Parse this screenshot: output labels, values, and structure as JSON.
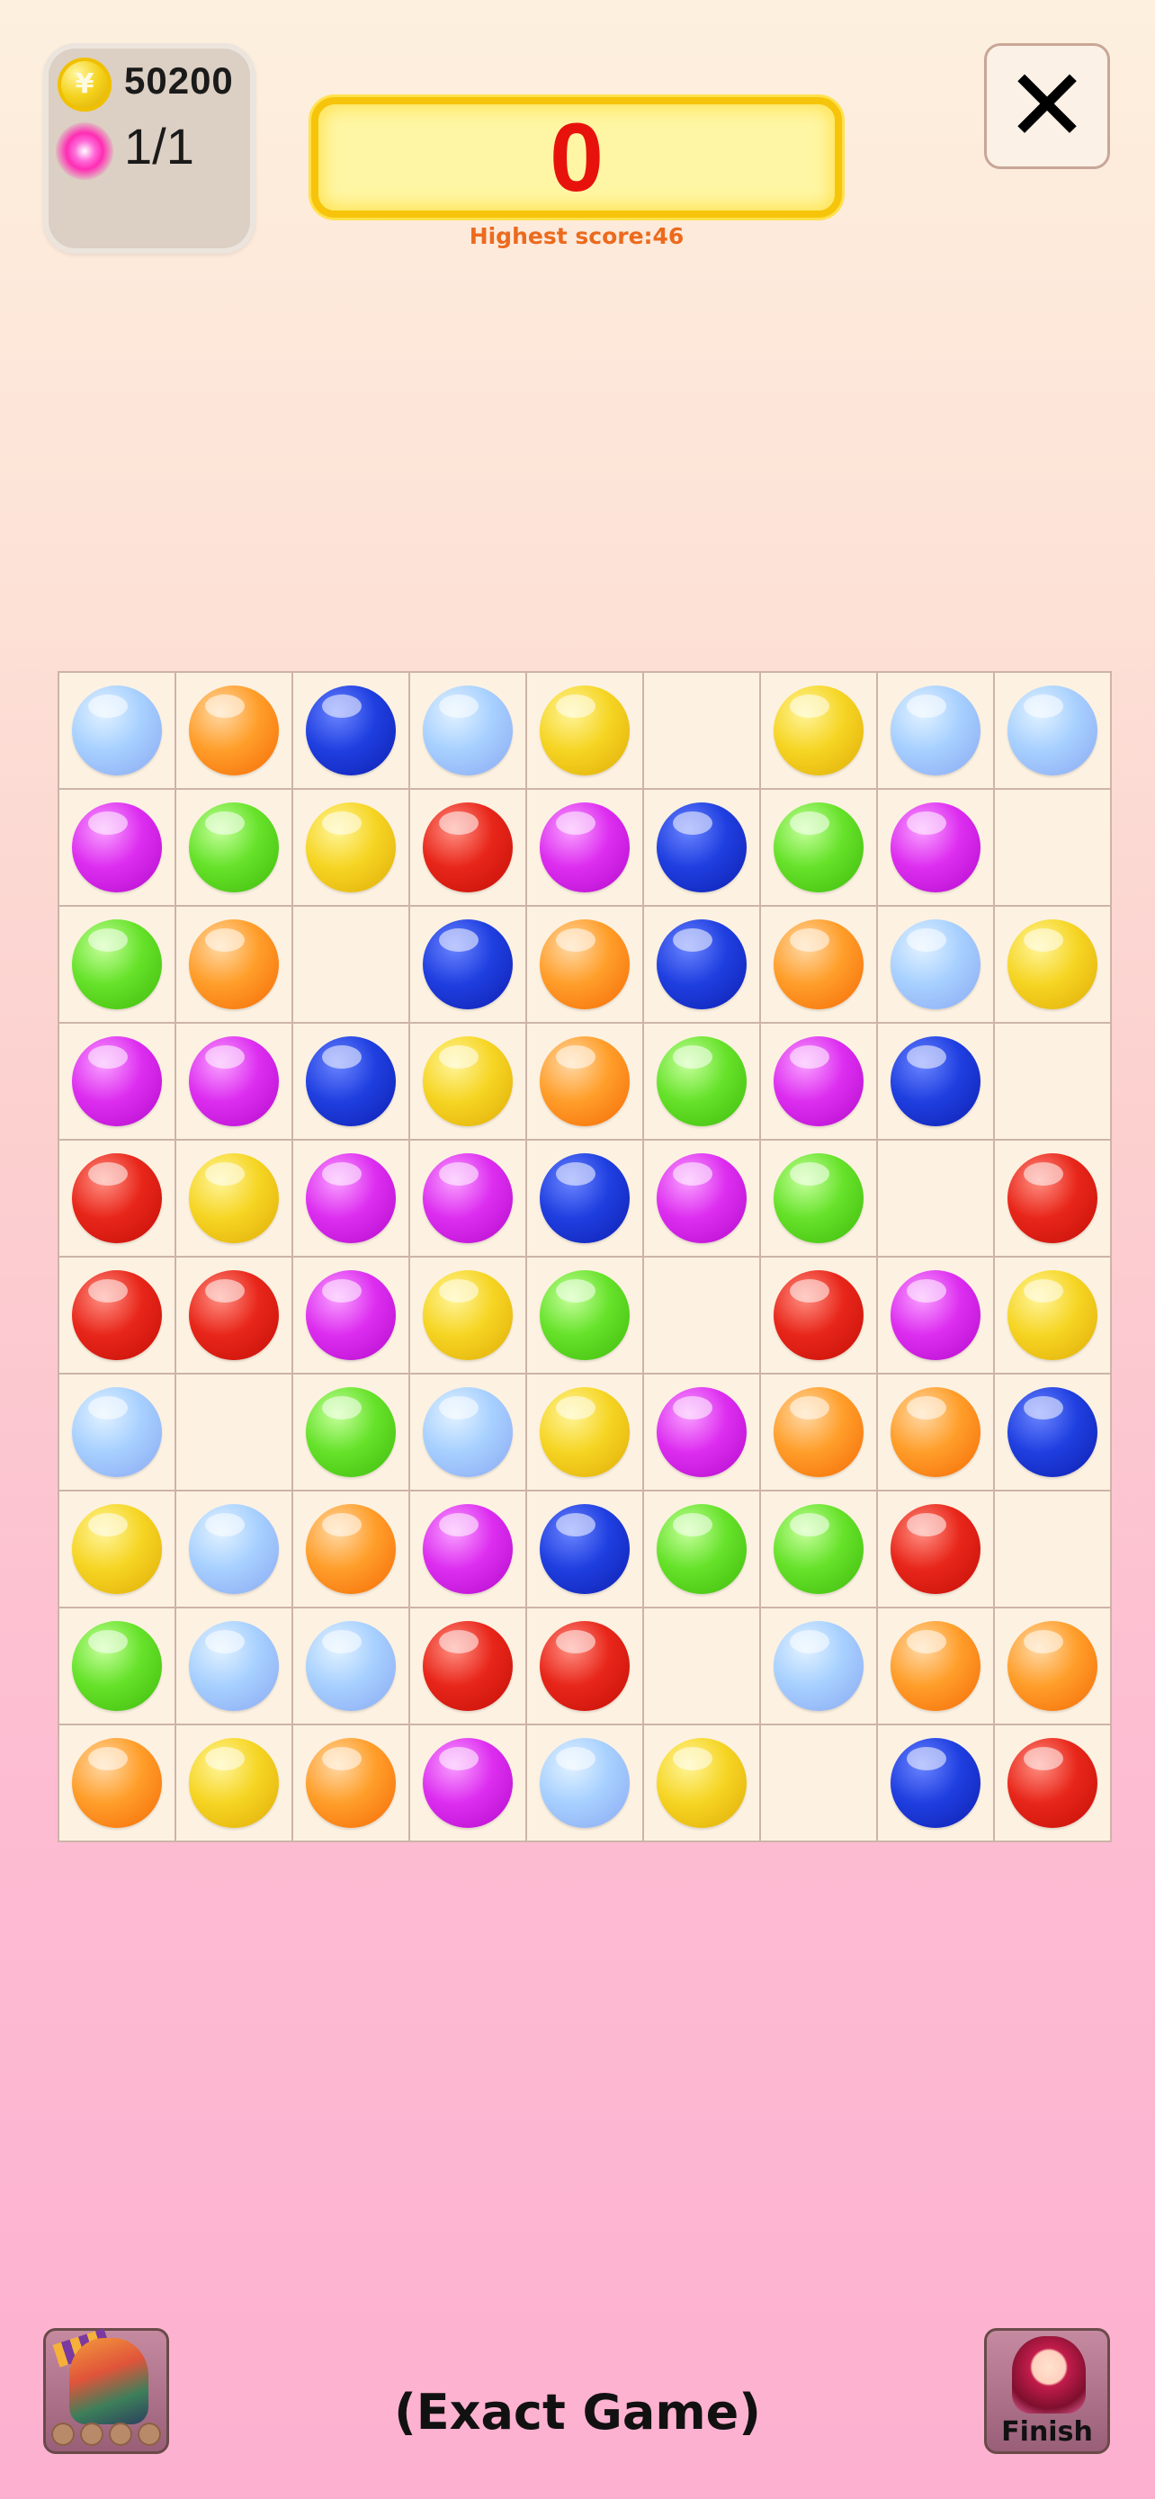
{
  "resources": {
    "coin_symbol": "¥",
    "coins": "50200",
    "energy": "1/1"
  },
  "score": {
    "current": "0",
    "best_label": "Highest score:46"
  },
  "close_icon_glyph": "✕",
  "board": {
    "rows": 10,
    "cols": 9,
    "color_palette": {
      "sky": "#a7d0ff",
      "orange": "#ff9e2a",
      "blue": "#1f3fe0",
      "yellow": "#f6d524",
      "purple": "#dd2ef0",
      "green": "#66e22a",
      "red": "#e8261a"
    },
    "grid": [
      [
        "sky",
        "orange",
        "blue",
        "sky",
        "yellow",
        null,
        "yellow",
        "sky",
        "sky"
      ],
      [
        "purple",
        "green",
        "yellow",
        "red",
        "purple",
        "blue",
        "green",
        "purple",
        null
      ],
      [
        "green",
        "orange",
        null,
        "blue",
        "orange",
        "blue",
        "orange",
        "sky",
        "yellow"
      ],
      [
        "purple",
        "purple",
        "blue",
        "yellow",
        "orange",
        "green",
        "purple",
        "blue",
        null
      ],
      [
        "red",
        "yellow",
        "purple",
        "purple",
        "blue",
        "purple",
        "green",
        null,
        "red"
      ],
      [
        "red",
        "red",
        "purple",
        "yellow",
        "green",
        null,
        "red",
        "purple",
        "yellow"
      ],
      [
        "sky",
        null,
        "green",
        "sky",
        "yellow",
        "purple",
        "orange",
        "orange",
        "blue"
      ],
      [
        "yellow",
        "sky",
        "orange",
        "purple",
        "blue",
        "green",
        "green",
        "red",
        null
      ],
      [
        "green",
        "sky",
        "sky",
        "red",
        "red",
        null,
        "sky",
        "orange",
        "orange"
      ],
      [
        "orange",
        "yellow",
        "orange",
        "purple",
        "sky",
        "yellow",
        null,
        "blue",
        "red"
      ]
    ]
  },
  "bottom": {
    "finish_label": "Finish",
    "caption": "(Exact Game)",
    "hero_slots": 4
  }
}
